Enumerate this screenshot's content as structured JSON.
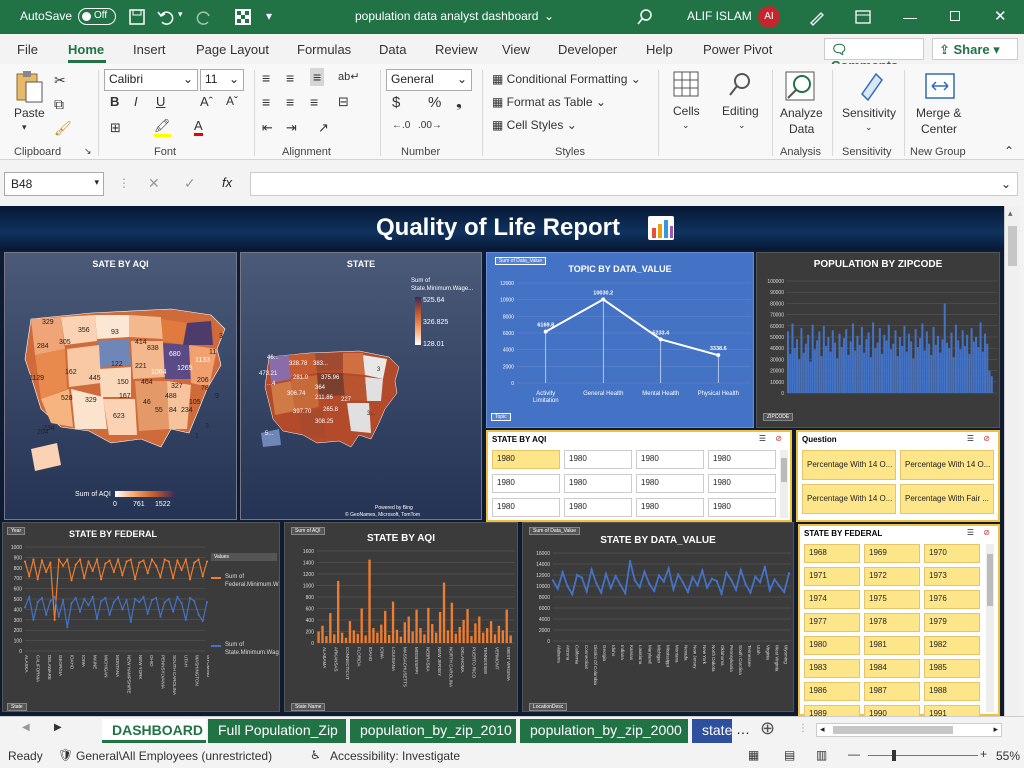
{
  "titlebar": {
    "autosave": "AutoSave",
    "toggle": "Off",
    "filename": "population data analyst dashboard",
    "user": "ALIF ISLAM",
    "initials": "AI"
  },
  "menu": [
    "File",
    "Home",
    "Insert",
    "Page Layout",
    "Formulas",
    "Data",
    "Review",
    "View",
    "Developer",
    "Help",
    "Power Pivot"
  ],
  "menu_right": {
    "comments": "Comments",
    "share": "Share"
  },
  "ribbon": {
    "paste": "Paste",
    "font_name": "Calibri",
    "font_size": "11",
    "number_format": "General",
    "conditional": "Conditional Formatting",
    "format_table": "Format as Table",
    "cell_styles": "Cell Styles",
    "cells": "Cells",
    "editing": "Editing",
    "analyze": "Analyze",
    "analyze2": "Data",
    "sensitivity": "Sensitivity",
    "merge": "Merge &",
    "merge2": "Center",
    "groups": [
      "Clipboard",
      "Font",
      "Alignment",
      "Number",
      "Styles",
      "Analysis",
      "Sensitivity",
      "New Group"
    ]
  },
  "namebox": "B48",
  "dashboard": {
    "title": "Quality of Life Report",
    "map1": {
      "title": "SATE BY AQI",
      "legend_title": "Sum of AQI",
      "legend_vals": [
        "0",
        "761",
        "1522"
      ],
      "labels": [
        "329",
        "356",
        "93",
        "414",
        "838",
        "680",
        "1133",
        "284",
        "305",
        "122",
        "221",
        "1064",
        "1265",
        "1129",
        "162",
        "445",
        "150",
        "464",
        "327",
        "206",
        "167",
        "46",
        "55",
        "84",
        "234",
        "528",
        "329",
        "623",
        "488",
        "234",
        "105",
        "204",
        "11",
        "3",
        "3",
        "1",
        "9",
        "78"
      ]
    },
    "map2": {
      "title": "STATE",
      "legend_title": "Sum of State.Minimum.Wage...",
      "legend_vals": [
        "525.64",
        "326.825",
        "128.01"
      ],
      "labels": [
        "46...",
        "328.78",
        "383...",
        "473.21",
        "281.0",
        "375.96",
        "...4",
        "364",
        "211.86",
        "227",
        "306.74",
        "265.8",
        "397.70",
        "308.25",
        "3...",
        "5...",
        "3"
      ],
      "credit": "Powered by Bing",
      "credit2": "© GeoNames, Microsoft, TomTom"
    },
    "topic": {
      "title": "TOPIC BY DATA_VALUE",
      "field": "Sum of Data_Value",
      "filter": "Topic"
    },
    "popzip": {
      "title": "POPULATION BY ZIPCODE",
      "filter": "ZIPCODE"
    },
    "slicer_aqi": {
      "title": "STATE BY AQI",
      "items": [
        "1980",
        "1980",
        "1980",
        "1980",
        "1980",
        "1980",
        "1980",
        "1980",
        "1980",
        "1980",
        "1980",
        "1980"
      ]
    },
    "slicer_q": {
      "title": "Question",
      "items": [
        "Percentage With 14 O...",
        "Percentage With 14 O...",
        "Percentage With 14 O...",
        "Percentage With Fair ..."
      ]
    },
    "federal": {
      "title": "STATE BY FEDERAL",
      "filter_year": "Year",
      "filter_state": "State",
      "legend_head": "Values",
      "legend1": "Sum of Federal.Minimum.Wage.2020.Dollars",
      "legend2": "Sum of State.Minimum.Wage.2020.Dollars"
    },
    "aqi_bar": {
      "title": "STATE BY AQI",
      "field": "Sum of AQI",
      "filter": "State Name"
    },
    "dv_line": {
      "title": "STATE BY DATA_VALUE",
      "field": "Sum of Data_Value",
      "filter": "LocationDesc"
    },
    "slicer_fed": {
      "title": "STATE BY FEDERAL",
      "items": [
        "1968",
        "1969",
        "1970",
        "1971",
        "1972",
        "1973",
        "1974",
        "1975",
        "1976",
        "1977",
        "1978",
        "1979",
        "1980",
        "1981",
        "1982",
        "1983",
        "1984",
        "1985",
        "1986",
        "1987",
        "1988",
        "1989",
        "1990",
        "1991"
      ]
    }
  },
  "tabs": [
    "DASHBOARD",
    "Full Population_Zip",
    "population_by_zip_2010",
    "population_by_zip_2000",
    "state"
  ],
  "status": {
    "ready": "Ready",
    "sensitivity": "General\\All Employees (unrestricted)",
    "accessibility": "Accessibility: Investigate",
    "zoom": "55%"
  },
  "chart_data": [
    {
      "type": "line",
      "title": "TOPIC BY DATA_VALUE",
      "categories": [
        "Activity Limitation",
        "General Health",
        "Mental Health",
        "Physical Health"
      ],
      "values": [
        6169.8,
        10030.2,
        5233.4,
        3338.6
      ],
      "ylim": [
        0,
        12000
      ],
      "yticks": [
        "0",
        "2000",
        "4000",
        "6000",
        "8000",
        "10000",
        "12000"
      ]
    },
    {
      "type": "bar",
      "title": "POPULATION BY ZIPCODE",
      "ylim": [
        0,
        100000
      ],
      "yticks": [
        "0",
        "10000",
        "20000",
        "30000",
        "40000",
        "50000",
        "60000",
        "70000",
        "80000",
        "90000",
        "100000"
      ],
      "values": [
        55000,
        35000,
        62000,
        40000,
        48000,
        30000,
        58000,
        36000,
        44000,
        52000,
        28000,
        61000,
        39000,
        47000,
        55000,
        33000,
        60000,
        42000,
        50000,
        37000,
        56000,
        45000,
        31000,
        53000,
        41000,
        49000,
        57000,
        34000,
        46000,
        62000,
        38000,
        51000,
        43000,
        59000,
        36000,
        48000,
        54000,
        32000,
        63000,
        40000,
        45000,
        58000,
        35000,
        52000,
        47000,
        61000,
        39000,
        44000,
        56000,
        33000,
        50000,
        42000,
        60000,
        37000,
        53000,
        46000,
        31000,
        57000,
        41000,
        49000,
        62000,
        38000,
        55000,
        44000,
        34000,
        59000,
        43000,
        51000,
        36000,
        48000,
        80000,
        45000,
        40000,
        54000,
        32000,
        61000,
        47000,
        39000,
        56000,
        42000,
        52000,
        35000,
        58000,
        46000,
        50000,
        41000,
        63000,
        37000,
        53000,
        44000,
        20000,
        15000
      ]
    },
    {
      "type": "line",
      "title": "STATE BY FEDERAL",
      "categories": [
        "ALASKA",
        "CALIFORNIA",
        "DELAWARE",
        "GEORGIA",
        "IDAHO",
        "IOWA",
        "MAINE",
        "MICHIGAN",
        "MONTANA",
        "NEW HAMPSHIRE",
        "NEW YORK",
        "OHIO",
        "PENNSYLVANIA",
        "SOUTH CAROLINA",
        "UTAH",
        "WASHINGTON",
        "WYOMING"
      ],
      "ylim": [
        0,
        1000
      ],
      "yticks": [
        "0",
        "100",
        "200",
        "300",
        "400",
        "500",
        "600",
        "700",
        "800",
        "900",
        "1000"
      ],
      "series": [
        {
          "name": "Sum of Federal.Minimum.Wage.2020.Dollars",
          "values": [
            860,
            720,
            880,
            690,
            870,
            760,
            850,
            300,
            880,
            820,
            880,
            680,
            830,
            880,
            700,
            860,
            770,
            880,
            690,
            840,
            870,
            760,
            880,
            730,
            860,
            880,
            690,
            850,
            870,
            750,
            880,
            820,
            710,
            880,
            860,
            700,
            870,
            780,
            880,
            690,
            850,
            880,
            720,
            860
          ]
        },
        {
          "name": "Sum of State.Minimum.Wage.2020.Dollars",
          "values": [
            420,
            520,
            300,
            470,
            510,
            350,
            480,
            520,
            330,
            490,
            230,
            460,
            510,
            380,
            500,
            440,
            520,
            310,
            480,
            510,
            350,
            470,
            520,
            400,
            490,
            280,
            500,
            470,
            520,
            360,
            490,
            510,
            330,
            470,
            500,
            380,
            520,
            460,
            300,
            510,
            480,
            350,
            290,
            470
          ]
        }
      ]
    },
    {
      "type": "bar",
      "title": "STATE BY AQI",
      "categories": [
        "ALABAMA",
        "ARKANSAS",
        "CONNECTICUT",
        "FLORIDA",
        "IDAHO",
        "IOWA",
        "LOUISIANA",
        "MASSACHUSETTS",
        "MISSISSIPPI",
        "NEBRASKA",
        "NEW JERSEY",
        "NORTH CAROLINA",
        "OKLAHOMA",
        "PUERTO RICO",
        "TENNESSEE",
        "VERMONT",
        "WEST VIRGINIA"
      ],
      "ylim": [
        0,
        1600
      ],
      "yticks": [
        "0",
        "200",
        "400",
        "600",
        "800",
        "1000",
        "1200",
        "1400",
        "1600"
      ],
      "values": [
        200,
        300,
        120,
        520,
        150,
        1080,
        180,
        90,
        380,
        220,
        160,
        600,
        130,
        1450,
        260,
        180,
        320,
        560,
        140,
        720,
        230,
        110,
        360,
        460,
        200,
        580,
        260,
        150,
        610,
        330,
        180,
        540,
        1050,
        220,
        700,
        160,
        280,
        400,
        590,
        120,
        340,
        460,
        180,
        260,
        380,
        150,
        300,
        220,
        580,
        130
      ]
    },
    {
      "type": "line",
      "title": "STATE BY DATA_VALUE",
      "categories": [
        "Alabama",
        "Arizona",
        "California",
        "Connecticut",
        "District Of Columbia",
        "Georgia",
        "Idaho",
        "Indiana",
        "Kansas",
        "Louisiana",
        "Maryland",
        "Michigan",
        "Mississippi",
        "Montana",
        "Nevada",
        "New Jersey",
        "New York",
        "North Dakota",
        "Oklahoma",
        "Pennsylvania",
        "South Carolina",
        "Tennessee",
        "Utah",
        "Virginia",
        "West Virginia",
        "Wyoming"
      ],
      "ylim": [
        0,
        16000
      ],
      "yticks": [
        "0",
        "2000",
        "4000",
        "6000",
        "8000",
        "10000",
        "12000",
        "14000",
        "16000"
      ],
      "values": [
        11000,
        9500,
        12500,
        10000,
        8500,
        12000,
        11500,
        9000,
        13000,
        10500,
        8800,
        12200,
        9600,
        11800,
        10200,
        8700,
        14500,
        11000,
        9800,
        12600,
        10400,
        9100,
        11900,
        10800,
        13200,
        9400,
        12100,
        10600,
        8900,
        11600,
        10100,
        12800,
        9700,
        11300,
        10900,
        8600,
        12400,
        11100,
        9300,
        12900,
        10300,
        8800,
        11700,
        10700,
        13500,
        9200,
        11200,
        10000,
        8900,
        12300
      ]
    }
  ]
}
